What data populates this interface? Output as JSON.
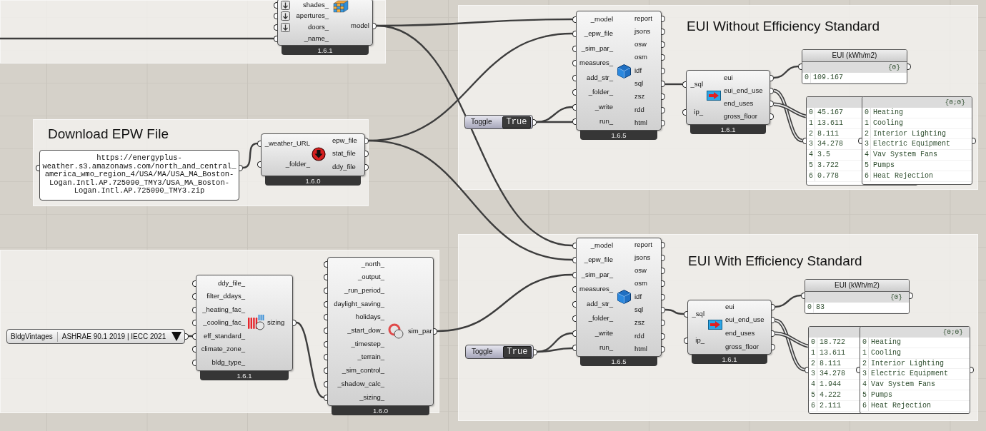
{
  "groups": [
    {
      "title": "Download EPW File"
    },
    {
      "title": "EUI Without Efficiency Standard"
    },
    {
      "title": "EUI With Efficiency Standard"
    }
  ],
  "components": [
    {
      "inputs": [
        {
          "label": "shades_",
          "flattened": true
        },
        {
          "label": "apertures_",
          "flattened": true
        },
        {
          "label": "doors_",
          "flattened": true
        },
        {
          "label": "_name_",
          "flattened": false
        }
      ],
      "outputs": [
        "model"
      ],
      "version": "1.6.1"
    },
    {
      "inputs": [
        {
          "label": "_weather_URL"
        },
        {
          "label": "_folder_"
        }
      ],
      "outputs": [
        "epw_file",
        "stat_file",
        "ddy_file"
      ],
      "version": "1.6.0"
    },
    {
      "inputs": [
        {
          "label": "_model"
        },
        {
          "label": "_epw_file"
        },
        {
          "label": "_sim_par_"
        },
        {
          "label": "measures_"
        },
        {
          "label": "add_str_"
        },
        {
          "label": "_folder_"
        },
        {
          "label": "_write"
        },
        {
          "label": "run_"
        }
      ],
      "outputs": [
        "report",
        "jsons",
        "osw",
        "osm",
        "idf",
        "sql",
        "zsz",
        "rdd",
        "html"
      ],
      "version": "1.6.5"
    },
    {
      "inputs": [
        {
          "label": "_sql"
        },
        {
          "label": "ip_"
        }
      ],
      "outputs": [
        "eui",
        "eui_end_use",
        "end_uses",
        "gross_floor"
      ],
      "version": "1.6.1"
    },
    {
      "inputs": [
        {
          "label": "ddy_file_"
        },
        {
          "label": "filter_ddays_"
        },
        {
          "label": "_heating_fac_"
        },
        {
          "label": "_cooling_fac_"
        },
        {
          "label": "eff_standard_"
        },
        {
          "label": "climate_zone_"
        },
        {
          "label": "bldg_type_"
        }
      ],
      "outputs": [
        "sizing"
      ],
      "version": "1.6.1"
    },
    {
      "inputs": [
        {
          "label": "_north_"
        },
        {
          "label": "_output_"
        },
        {
          "label": "_run_period_"
        },
        {
          "label": "daylight_saving_"
        },
        {
          "label": "holidays_"
        },
        {
          "label": "_start_dow_"
        },
        {
          "label": "_timestep_"
        },
        {
          "label": "_terrain_"
        },
        {
          "label": "_sim_control_"
        },
        {
          "label": "_shadow_calc_"
        },
        {
          "label": "_sizing_"
        }
      ],
      "outputs": [
        "sim_par"
      ],
      "version": "1.6.0"
    },
    {
      "inputs": [
        {
          "label": "_model"
        },
        {
          "label": "_epw_file"
        },
        {
          "label": "_sim_par_"
        },
        {
          "label": "measures_"
        },
        {
          "label": "add_str_"
        },
        {
          "label": "_folder_"
        },
        {
          "label": "_write"
        },
        {
          "label": "run_"
        }
      ],
      "outputs": [
        "report",
        "jsons",
        "osw",
        "osm",
        "idf",
        "sql",
        "zsz",
        "rdd",
        "html"
      ],
      "version": "1.6.5"
    },
    {
      "inputs": [
        {
          "label": "_sql"
        },
        {
          "label": "ip_"
        }
      ],
      "outputs": [
        "eui",
        "eui_end_use",
        "end_uses",
        "gross_floor"
      ],
      "version": "1.6.1"
    }
  ],
  "text_panel": {
    "lines": [
      "https://energyplus-",
      "weather.s3.amazonaws.com/north_and_central_",
      "america_wmo_region_4/USA/MA/USA_MA_Boston-",
      "Logan.Intl.AP.725090_TMY3/USA_MA_Boston-",
      "Logan.Intl.AP.725090_TMY3.zip"
    ]
  },
  "value_list": {
    "label": "BldgVintages",
    "selection": "ASHRAE 90.1 2019 | IECC 2021"
  },
  "toggles": [
    {
      "label": "Toggle",
      "value": "True",
      "on": true
    },
    {
      "label": "Toggle",
      "value": "True",
      "on": true
    }
  ],
  "data_panels": [
    {
      "title": "EUI (kWh/m2)",
      "path": "{0}",
      "rows": [
        {
          "index": "0",
          "value": "109.167"
        }
      ]
    },
    {
      "rows": [
        {
          "index": "0",
          "value": "45.167"
        },
        {
          "index": "1",
          "value": "13.611"
        },
        {
          "index": "2",
          "value": "8.111"
        },
        {
          "index": "3",
          "value": "34.278"
        },
        {
          "index": "4",
          "value": "3.5"
        },
        {
          "index": "5",
          "value": "3.722"
        },
        {
          "index": "6",
          "value": "0.778"
        }
      ]
    },
    {
      "path": "{0;0}",
      "rows": [
        {
          "index": "0",
          "value": "Heating"
        },
        {
          "index": "1",
          "value": "Cooling"
        },
        {
          "index": "2",
          "value": "Interior Lighting"
        },
        {
          "index": "3",
          "value": "Electric Equipment"
        },
        {
          "index": "4",
          "value": "Vav System Fans"
        },
        {
          "index": "5",
          "value": "Pumps"
        },
        {
          "index": "6",
          "value": "Heat Rejection"
        }
      ]
    },
    {
      "title": "EUI (kWh/m2)",
      "path": "{0}",
      "rows": [
        {
          "index": "0",
          "value": "83"
        }
      ]
    },
    {
      "rows": [
        {
          "index": "0",
          "value": "18.722"
        },
        {
          "index": "1",
          "value": "13.611"
        },
        {
          "index": "2",
          "value": "8.111"
        },
        {
          "index": "3",
          "value": "34.278"
        },
        {
          "index": "4",
          "value": "1.944"
        },
        {
          "index": "5",
          "value": "4.222"
        },
        {
          "index": "6",
          "value": "2.111"
        }
      ]
    },
    {
      "path": "{0;0}",
      "rows": [
        {
          "index": "0",
          "value": "Heating"
        },
        {
          "index": "1",
          "value": "Cooling"
        },
        {
          "index": "2",
          "value": "Interior Lighting"
        },
        {
          "index": "3",
          "value": "Electric Equipment"
        },
        {
          "index": "4",
          "value": "Vav System Fans"
        },
        {
          "index": "5",
          "value": "Pumps"
        },
        {
          "index": "6",
          "value": "Heat Rejection"
        }
      ]
    }
  ]
}
